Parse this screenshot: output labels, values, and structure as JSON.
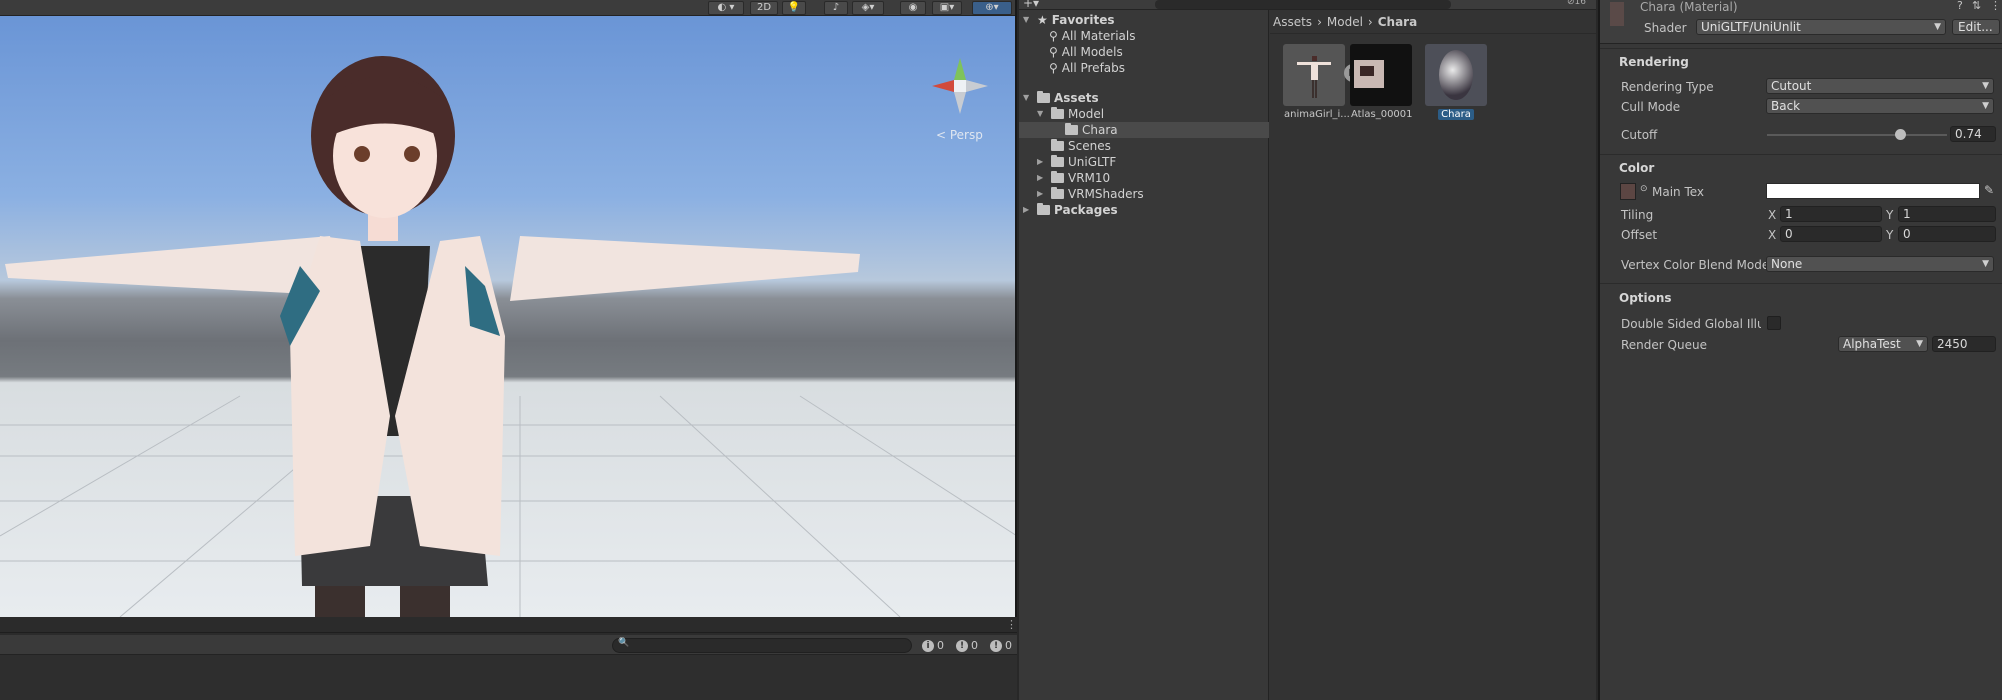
{
  "scene": {
    "toolbar": {
      "mode_2d": "2D"
    },
    "gizmo": {
      "persp_label": "< Persp",
      "x_axis": "x"
    }
  },
  "console": {
    "counts": {
      "info": "0",
      "warning": "0",
      "error": "0"
    }
  },
  "project": {
    "favorites": {
      "label": "Favorites",
      "items": [
        "All Materials",
        "All Models",
        "All Prefabs"
      ]
    },
    "assets": {
      "label": "Assets",
      "model": "Model",
      "chara": "Chara",
      "scenes": "Scenes",
      "unigltf": "UniGLTF",
      "vrm10": "VRM10",
      "vrmshaders": "VRMShaders"
    },
    "packages": "Packages",
    "breadcrumb": [
      "Assets",
      "Model",
      "Chara"
    ],
    "grid_items": [
      {
        "label": "animaGirl_i..."
      },
      {
        "label": "Atlas_00001"
      },
      {
        "label": "Chara"
      }
    ],
    "hidden_count": "16"
  },
  "inspector": {
    "title": "Chara (Material)",
    "shader_label": "Shader",
    "shader_value": "UniGLTF/UniUnlit",
    "edit_button": "Edit...",
    "rendering": {
      "header": "Rendering",
      "rendering_type_label": "Rendering Type",
      "rendering_type_value": "Cutout",
      "cull_mode_label": "Cull Mode",
      "cull_mode_value": "Back",
      "cutoff_label": "Cutoff",
      "cutoff_value": "0.74",
      "cutoff_fraction": 0.74
    },
    "color": {
      "header": "Color",
      "main_tex_label": "Main Tex",
      "main_tex_color": "#ffffff",
      "tiling_label": "Tiling",
      "tiling_x": "1",
      "tiling_y": "1",
      "offset_label": "Offset",
      "offset_x": "0",
      "offset_y": "0",
      "x_label": "X",
      "y_label": "Y",
      "vertex_blend_label": "Vertex Color Blend Mode",
      "vertex_blend_value": "None"
    },
    "options": {
      "header": "Options",
      "double_sided_label": "Double Sided Global Illum",
      "render_queue_label": "Render Queue",
      "render_queue_preset": "AlphaTest",
      "render_queue_value": "2450"
    }
  }
}
